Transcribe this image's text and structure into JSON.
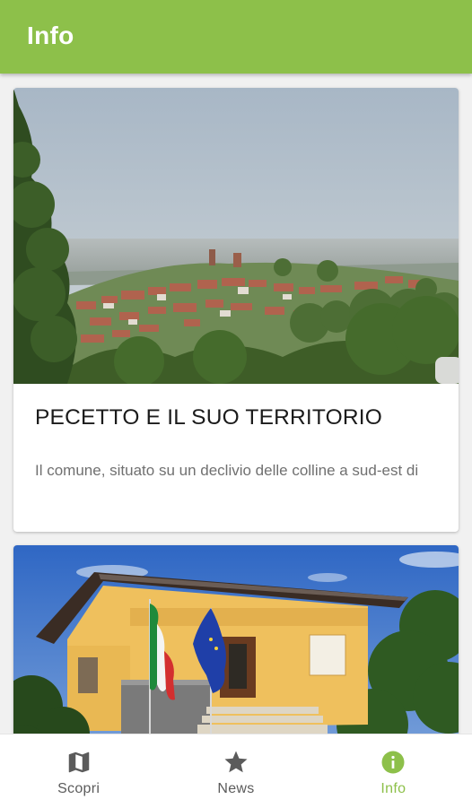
{
  "app_bar": {
    "title": "Info"
  },
  "cards": [
    {
      "title": "PECETTO E IL SUO TERRITORIO",
      "description": "Il comune, situato su un declivio delle colline a sud-est di",
      "image": "hillside-town-landscape"
    },
    {
      "image": "municipal-building-with-flags"
    }
  ],
  "bottom_nav": {
    "items": [
      {
        "label": "Scopri",
        "icon": "map-icon",
        "active": false
      },
      {
        "label": "News",
        "icon": "star-icon",
        "active": false
      },
      {
        "label": "Info",
        "icon": "info-icon",
        "active": true
      }
    ]
  },
  "colors": {
    "primary": "#8dc04a",
    "inactive_nav": "#5b5b5b",
    "card_title": "#1b1b1b",
    "card_text": "#707070"
  }
}
